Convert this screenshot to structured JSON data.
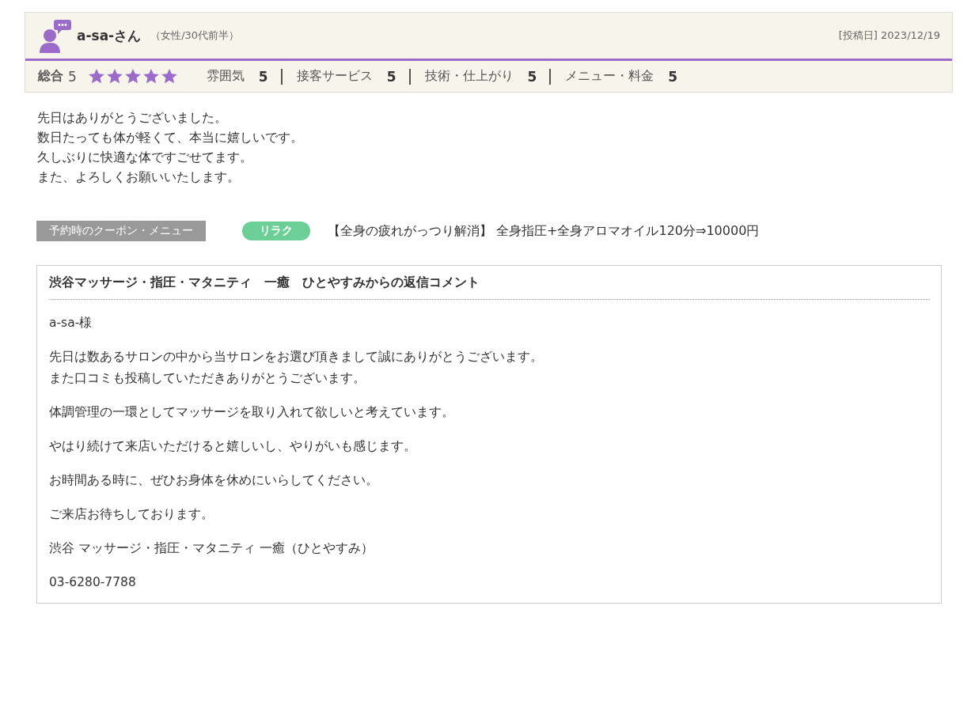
{
  "review": {
    "author": "a-sa-さん",
    "profile": "（女性/30代前半）",
    "posted": "[投稿日] 2023/12/19",
    "overall": {
      "label": "総合",
      "value": "5",
      "stars": 5
    },
    "ratings": [
      {
        "label": "雰囲気",
        "value": "5"
      },
      {
        "label": "接客サービス",
        "value": "5"
      },
      {
        "label": "技術・仕上がり",
        "value": "5"
      },
      {
        "label": "メニュー・料金",
        "value": "5"
      }
    ],
    "body": [
      "先日はありがとうございました。",
      "数日たっても体が軽くて、本当に嬉しいです。",
      "久しぶりに快適な体ですごせてます。",
      "また、よろしくお願いいたします。"
    ],
    "coupon": {
      "label": "予約時のクーポン・メニュー",
      "tag": "リラク",
      "text": "【全身の疲れがっつり解消】 全身指圧+全身アロマオイル120分⇒10000円"
    },
    "reply": {
      "title": "渋谷マッサージ・指圧・マタニティ　一癒　ひとやすみからの返信コメント",
      "paragraphs": [
        [
          "a-sa-様"
        ],
        [
          "先日は数あるサロンの中から当サロンをお選び頂きまして誠にありがとうございます。",
          "また口コミも投稿していただきありがとうございます。"
        ],
        [
          "体調管理の一環としてマッサージを取り入れて欲しいと考えています。"
        ],
        [
          "やはり続けて来店いただけると嬉しいし、やりがいも感じます。"
        ],
        [
          "お時間ある時に、ぜひお身体を休めにいらしてください。"
        ],
        [
          "ご来店お待ちしております。"
        ],
        [
          "渋谷 マッサージ・指圧・マタニティ 一癒（ひとやすみ）"
        ],
        [
          "03-6280-7788"
        ]
      ]
    }
  }
}
